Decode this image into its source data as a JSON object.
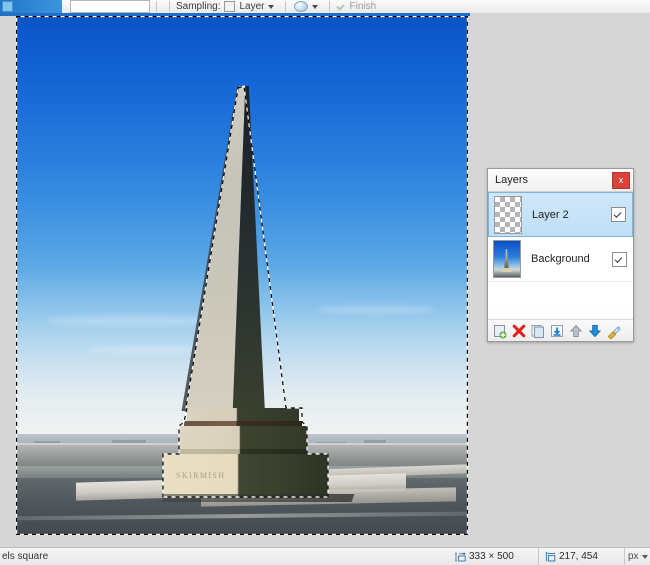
{
  "toolbar": {
    "sampling_label": "Sampling:",
    "layer_label": "Layer",
    "finish_label": "Finish",
    "swatch_icon": "color-swatch-icon",
    "dropdown_icon": "chevron-down-icon",
    "blob_icon": "brush-blob-icon",
    "checkbox_icon": "checkbox-icon",
    "field_value": ""
  },
  "layers_panel": {
    "title": "Layers",
    "close_label": "x",
    "layers": [
      {
        "name": "Layer 2",
        "visible": true,
        "selected": true,
        "thumb": "transparent-checker-thumbnail"
      },
      {
        "name": "Background",
        "visible": true,
        "selected": false,
        "thumb": "obelisk-photo-thumbnail"
      }
    ],
    "tools": [
      {
        "name": "add-layer-icon",
        "title": "Add new layer"
      },
      {
        "name": "delete-layer-icon",
        "title": "Delete layer"
      },
      {
        "name": "duplicate-layer-icon",
        "title": "Duplicate layer"
      },
      {
        "name": "merge-layer-down-icon",
        "title": "Merge layer down"
      },
      {
        "name": "move-layer-up-icon",
        "title": "Move layer up"
      },
      {
        "name": "move-layer-down-icon",
        "title": "Move layer down"
      },
      {
        "name": "layer-properties-icon",
        "title": "Layer properties"
      }
    ],
    "accent_color": "#bfdff6",
    "close_color": "#d9433c"
  },
  "statusbar": {
    "left_text": "els square",
    "dimensions": "333 × 500",
    "cursor_position": "217, 454",
    "unit": "px",
    "dimensions_icon": "image-size-icon",
    "position_icon": "cursor-position-icon",
    "unit_caret_icon": "chevron-down-icon"
  },
  "image": {
    "alt": "Obelisk monument against blue sky with marching-ants selection",
    "base_inscription": "SKIRMISH",
    "selection_state": "active"
  }
}
